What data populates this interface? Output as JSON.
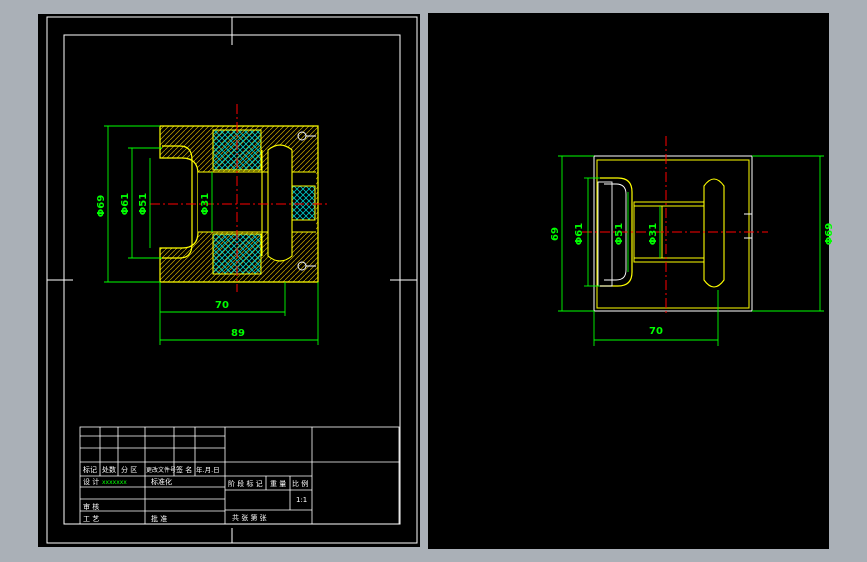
{
  "left_view": {
    "dims": {
      "d69": "Φ69",
      "d61": "Φ61",
      "d51": "Φ51",
      "d31": "Φ31",
      "w70": "70",
      "w89": "89"
    }
  },
  "right_view": {
    "dims": {
      "d69": "69",
      "d61": "Φ61",
      "d51": "Φ51",
      "d31": "Φ31",
      "d69b": "Φ69",
      "w70": "70"
    }
  },
  "title_block": {
    "biaoji": "标记",
    "chushu": "处数",
    "fenqu": "分 区",
    "gengai": "更改文件号",
    "qianming": "签 名",
    "nianyueri": "年.月.日",
    "sheji": "设 计",
    "designer": "xxxxxxx",
    "biaozhunhua": "标准化",
    "jieduan": "阶 段 标 记",
    "zhongliang": "重 量",
    "bili": "比 例",
    "scale": "1:1",
    "shenhe": "审 核",
    "gongyi": "工 艺",
    "pizhun": "批 准",
    "sheets": "共   张   第   张"
  },
  "colors": {
    "background": "#000000",
    "frame": "#ffffff",
    "dimension": "#00ff00",
    "center_line": "#ff0000",
    "outline": "#ffff00",
    "hidden": "#00ffff"
  }
}
